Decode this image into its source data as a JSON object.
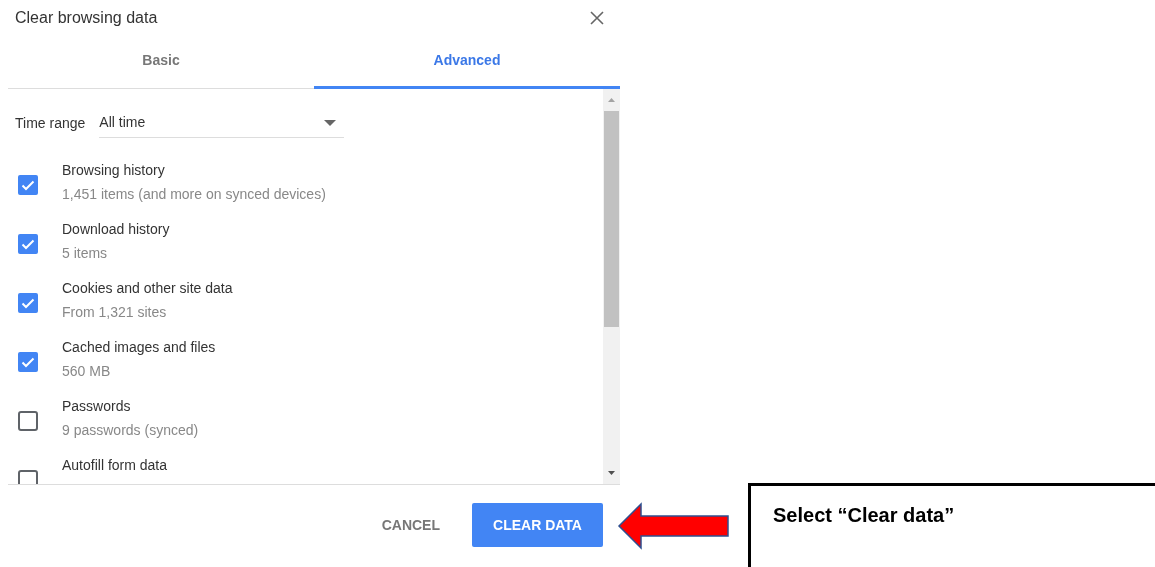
{
  "dialog": {
    "title": "Clear browsing data",
    "tabs": [
      {
        "label": "Basic",
        "selected": false
      },
      {
        "label": "Advanced",
        "selected": true
      }
    ],
    "time_range": {
      "label": "Time range",
      "value": "All time"
    },
    "items": [
      {
        "label": "Browsing history",
        "detail": "1,451 items (and more on synced devices)",
        "checked": true
      },
      {
        "label": "Download history",
        "detail": "5 items",
        "checked": true
      },
      {
        "label": "Cookies and other site data",
        "detail": "From 1,321 sites",
        "checked": true
      },
      {
        "label": "Cached images and files",
        "detail": "560 MB",
        "checked": true
      },
      {
        "label": "Passwords",
        "detail": "9 passwords (synced)",
        "checked": false
      },
      {
        "label": "Autofill form data",
        "checked": false
      }
    ],
    "buttons": [
      {
        "label": "CANCEL",
        "kind": "text"
      },
      {
        "label": "CLEAR DATA",
        "kind": "primary"
      }
    ]
  },
  "callout": {
    "text": "Select “Clear data”"
  }
}
